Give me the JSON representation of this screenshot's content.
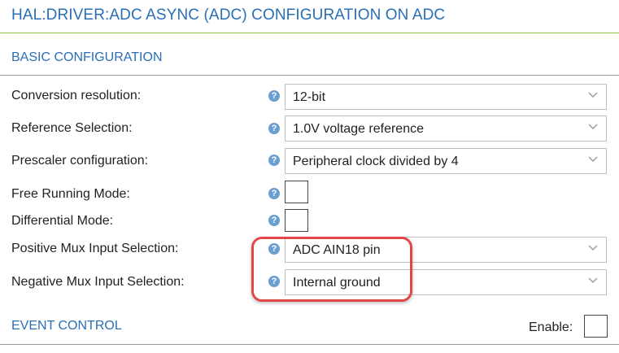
{
  "header": {
    "title": "HAL:DRIVER:ADC ASYNC (ADC) CONFIGURATION ON ADC"
  },
  "basic_configuration": {
    "section_title": "BASIC CONFIGURATION",
    "help_glyph": "?",
    "rows": [
      {
        "label": "Conversion resolution:",
        "value": "12-bit"
      },
      {
        "label": "Reference Selection:",
        "value": "1.0V voltage reference"
      },
      {
        "label": "Prescaler configuration:",
        "value": "Peripheral clock divided by 4"
      },
      {
        "label": "Free Running Mode:",
        "checked": false
      },
      {
        "label": "Differential Mode:",
        "checked": false
      },
      {
        "label": "Positive Mux Input Selection:",
        "value": "ADC AIN18 pin"
      },
      {
        "label": "Negative Mux Input Selection:",
        "value": "Internal ground"
      }
    ]
  },
  "event_control": {
    "section_title": "EVENT CONTROL",
    "enable_label": "Enable:",
    "enabled": false
  },
  "colors": {
    "title": "#2a6fb5",
    "title_rule": "#8dc63f",
    "help_icon": "#6a9fd0",
    "highlight": "#e04848"
  }
}
